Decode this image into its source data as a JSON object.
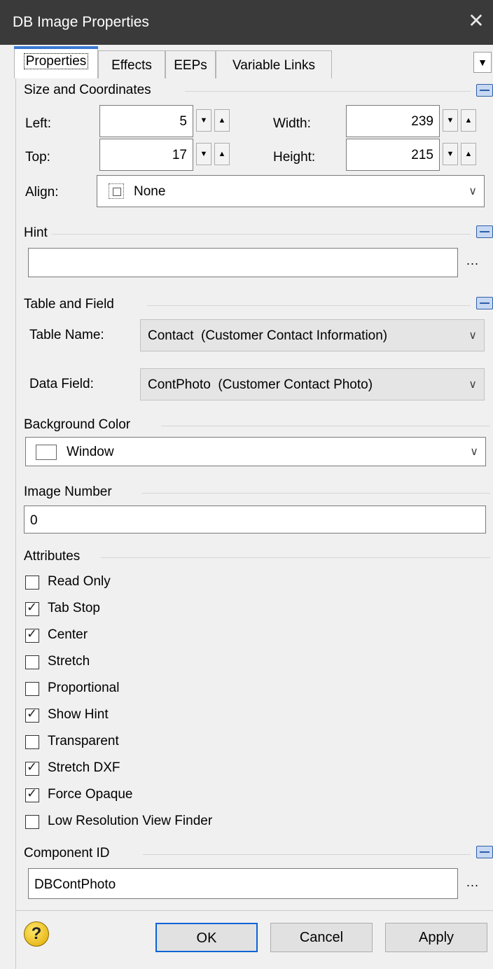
{
  "window": {
    "title": "DB Image Properties",
    "close_glyph": "✕"
  },
  "tabs": [
    {
      "label": "Properties",
      "active": true
    },
    {
      "label": "Effects"
    },
    {
      "label": "EEPs"
    },
    {
      "label": "Variable Links"
    }
  ],
  "tabs_overflow_glyph": "▼",
  "size_coords": {
    "title": "Size and Coordinates",
    "left_label": "Left:",
    "left_value": "5",
    "top_label": "Top:",
    "top_value": "17",
    "width_label": "Width:",
    "width_value": "239",
    "height_label": "Height:",
    "height_value": "215",
    "align_label": "Align:",
    "align_value": "None",
    "spin_down": "▼",
    "spin_up": "▲"
  },
  "hint": {
    "title": "Hint",
    "value": "",
    "ellipsis": "..."
  },
  "table_field": {
    "title": "Table and Field",
    "table_label": "Table Name:",
    "table_value": "Contact  (Customer Contact Information)",
    "field_label": "Data Field:",
    "field_value": "ContPhoto  (Customer Contact Photo)"
  },
  "background": {
    "title": "Background Color",
    "value": "Window"
  },
  "image_number": {
    "title": "Image Number",
    "value": "0"
  },
  "attributes": {
    "title": "Attributes",
    "items": [
      {
        "label": "Read Only",
        "checked": false
      },
      {
        "label": "Tab Stop",
        "checked": true
      },
      {
        "label": "Center",
        "checked": true
      },
      {
        "label": "Stretch",
        "checked": false
      },
      {
        "label": "Proportional",
        "checked": false
      },
      {
        "label": "Show Hint",
        "checked": true
      },
      {
        "label": "Transparent",
        "checked": false
      },
      {
        "label": "Stretch DXF",
        "checked": true
      },
      {
        "label": "Force Opaque",
        "checked": true
      },
      {
        "label": "Low Resolution View Finder",
        "checked": false
      }
    ]
  },
  "component": {
    "title": "Component ID",
    "value": "DBContPhoto",
    "ellipsis": "..."
  },
  "buttons": {
    "help_glyph": "?",
    "ok": "OK",
    "cancel": "Cancel",
    "apply": "Apply"
  },
  "chevron_glyph": "∨",
  "check_glyph": "✓",
  "colors": {
    "titlebar": "#3a3a3a",
    "accent": "#0a64d6",
    "collapse": "#2f5fa8"
  }
}
